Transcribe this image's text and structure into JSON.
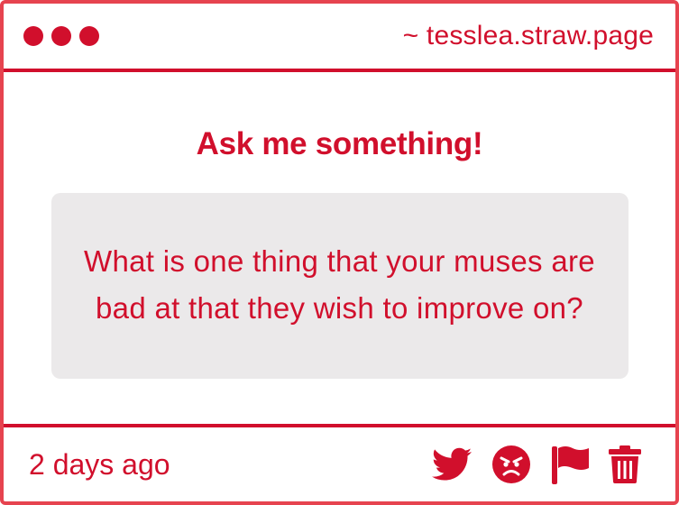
{
  "titlebar": {
    "dots": [
      "dot-1",
      "dot-2",
      "dot-3"
    ],
    "address": "~ tesslea.straw.page"
  },
  "main": {
    "heading": "Ask me something!",
    "question": "What is one thing that your muses are bad at that they wish to improve on?"
  },
  "footer": {
    "timestamp": "2 days ago",
    "actions": [
      {
        "icon": "twitter-icon"
      },
      {
        "icon": "angry-face-icon"
      },
      {
        "icon": "flag-icon"
      },
      {
        "icon": "trash-icon"
      }
    ]
  },
  "colors": {
    "accent": "#d10f2c",
    "border": "#e6434f",
    "question_bg": "#ebe9ea",
    "background": "#ffffff"
  }
}
